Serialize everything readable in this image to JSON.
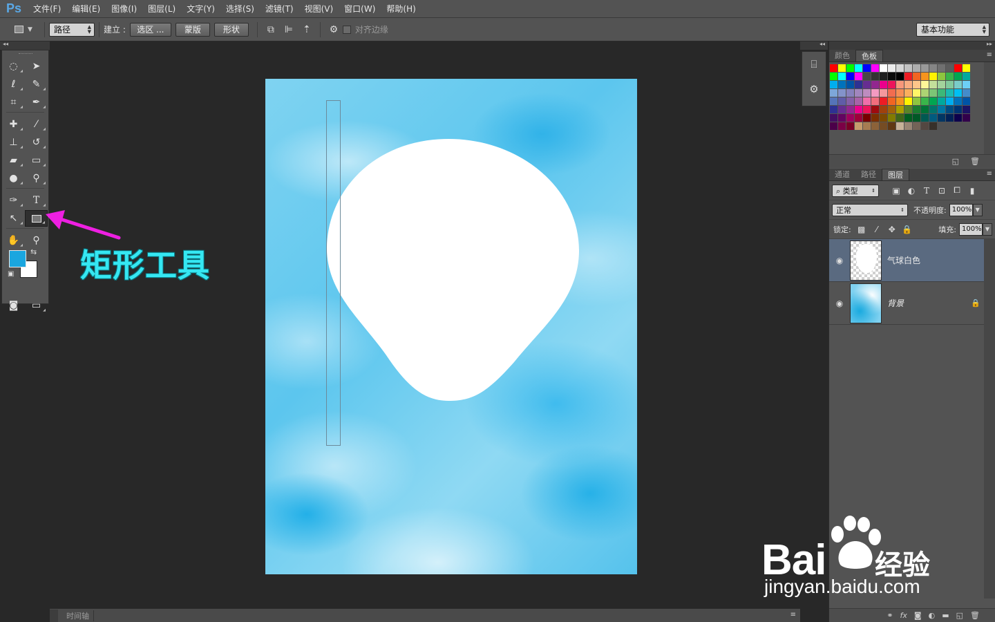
{
  "app": {
    "logo": "Ps"
  },
  "menu": [
    "文件(F)",
    "编辑(E)",
    "图像(I)",
    "图层(L)",
    "文字(Y)",
    "选择(S)",
    "滤镜(T)",
    "视图(V)",
    "窗口(W)",
    "帮助(H)"
  ],
  "options": {
    "mode_select": "路径",
    "make_label": "建立 :",
    "selection_btn": "选区 ...",
    "mask_btn": "蒙版",
    "shape_btn": "形状",
    "align_edges": "对齐边缘",
    "workspace": "基本功能"
  },
  "toolbox": {
    "foreground_color": "#1aa6df",
    "background_color": "#ffffff",
    "active_tool": "rectangle-tool"
  },
  "annotation": {
    "label": "矩形工具",
    "color": "#35e7f2",
    "arrow_color": "#ee1fe2"
  },
  "swatches_panel": {
    "tabs": [
      "颜色",
      "色板"
    ],
    "active_tab": "色板",
    "colors": [
      "#ff0000",
      "#ffff00",
      "#00ff00",
      "#00ffff",
      "#0000ff",
      "#ff00ff",
      "#ffffff",
      "#ebebeb",
      "#d6d6d6",
      "#c2c2c2",
      "#adadad",
      "#999999",
      "#858585",
      "#707070",
      "#5c5c5c",
      "#ff0000",
      "#ffff00",
      "#00ff00",
      "#00ffff",
      "#0000ff",
      "#ff00ff",
      "#474747",
      "#333333",
      "#1f1f1f",
      "#0a0a0a",
      "#000000",
      "#ee1d24",
      "#f26522",
      "#f7941d",
      "#fff200",
      "#8dc63f",
      "#39b54a",
      "#00a651",
      "#00a99d",
      "#00aeef",
      "#0072bc",
      "#0054a6",
      "#2e3192",
      "#662d91",
      "#92278f",
      "#ec008c",
      "#ed145b",
      "#f7977a",
      "#f9ad81",
      "#fdc68a",
      "#fff799",
      "#c4df9b",
      "#a3d39c",
      "#82ca9c",
      "#7accc8",
      "#6dcff6",
      "#7da7d9",
      "#8393ca",
      "#8781bd",
      "#a186be",
      "#bd8cbf",
      "#f49ac1",
      "#f5989d",
      "#f26c4f",
      "#f68e56",
      "#fbaf5d",
      "#fff568",
      "#acd373",
      "#7cc576",
      "#3cb878",
      "#1abbb4",
      "#00bff3",
      "#448ccb",
      "#5574b9",
      "#605ca8",
      "#8560a8",
      "#a864a8",
      "#f06eaa",
      "#f26d7d",
      "#ed1c24",
      "#f26522",
      "#f7941d",
      "#fff200",
      "#8dc63f",
      "#39b54a",
      "#00a651",
      "#00a99d",
      "#00aeef",
      "#0072bc",
      "#0054a6",
      "#2e3192",
      "#662d91",
      "#92278f",
      "#ec008c",
      "#ed145b",
      "#9e0b0f",
      "#a0410d",
      "#a3620a",
      "#aba000",
      "#598527",
      "#1a7b30",
      "#007236",
      "#00746b",
      "#0076a3",
      "#004b80",
      "#003471",
      "#1b1464",
      "#440e62",
      "#630460",
      "#9e005d",
      "#9e0039",
      "#790000",
      "#7b2e00",
      "#7d4900",
      "#827b00",
      "#406618",
      "#005e20",
      "#005826",
      "#005952",
      "#005b7f",
      "#003663",
      "#002157",
      "#0d004c",
      "#32004b",
      "#4b0049",
      "#7b0046",
      "#7a0026",
      "#c69c6d",
      "#a67c52",
      "#8c6239",
      "#754c24",
      "#603813",
      "#c7b299",
      "#998675",
      "#736357",
      "#534741",
      "#37302a"
    ]
  },
  "layers_panel": {
    "tabs": [
      "通道",
      "路径",
      "图层"
    ],
    "active_tab": "图层",
    "filter_kind": "类型",
    "blend_mode": "正常",
    "opacity_label": "不透明度:",
    "opacity": "100%",
    "lock_label": "锁定:",
    "fill_label": "填充:",
    "fill": "100%",
    "layers": [
      {
        "name": "气球白色",
        "selected": true,
        "locked": false
      },
      {
        "name": "背景",
        "selected": false,
        "locked": true
      }
    ]
  },
  "timeline": {
    "title": "时间轴"
  },
  "watermark": {
    "brand": "Bai",
    "brand_suffix": "经验",
    "url": "jingyan.baidu.com"
  }
}
